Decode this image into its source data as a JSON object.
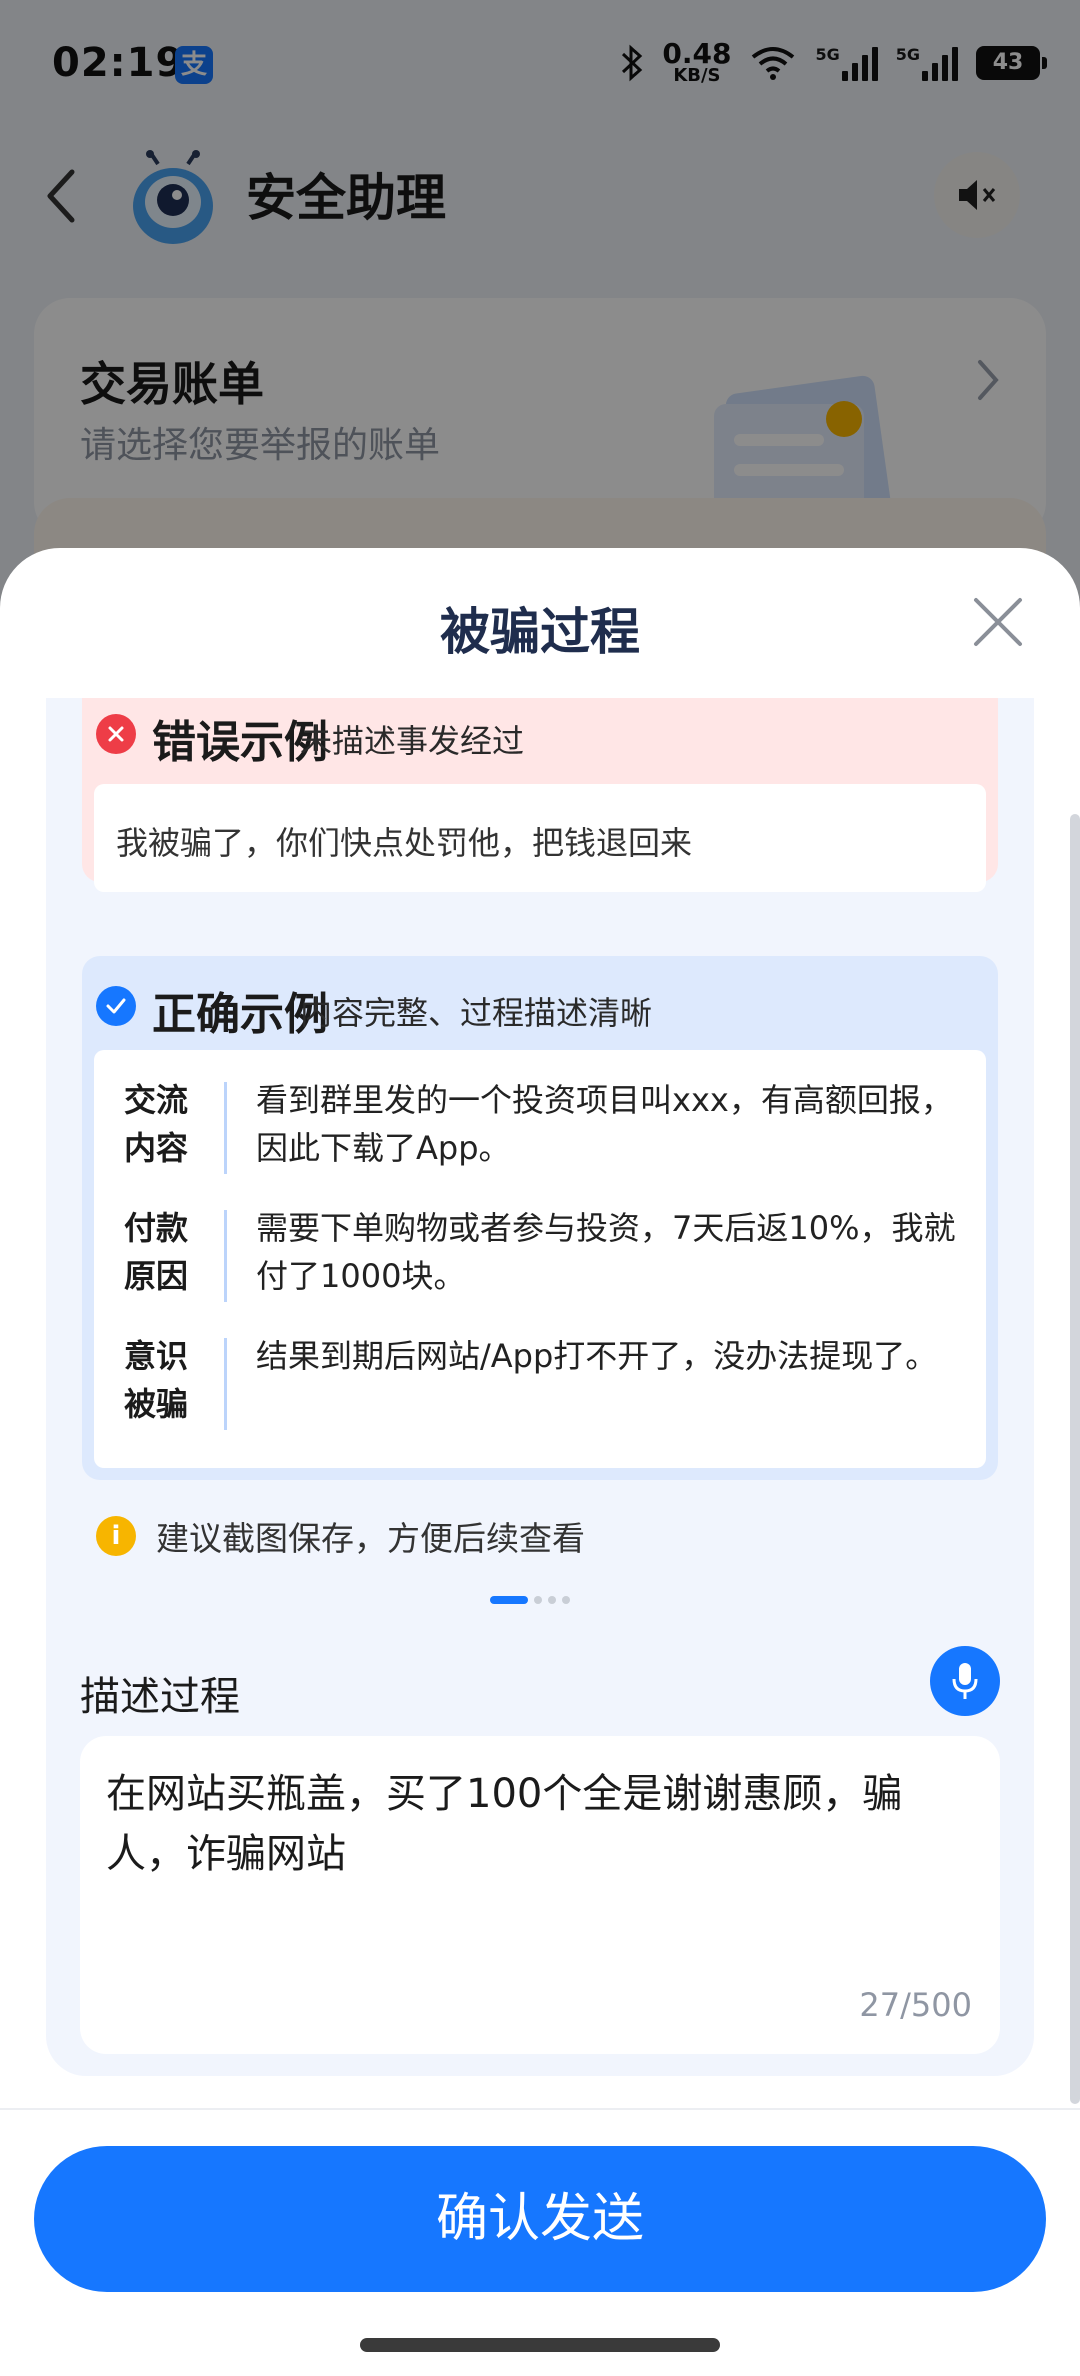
{
  "status_bar": {
    "time": "02:19",
    "notification_badge": "支",
    "net_speed_value": "0.48",
    "net_speed_unit": "KB/S",
    "signal_1_label": "5G",
    "signal_2_label": "5G",
    "battery": "43"
  },
  "header": {
    "title": "安全助理"
  },
  "bill_card": {
    "title": "交易账单",
    "subtitle": "请选择您要举报的账单"
  },
  "sheet": {
    "title": "被骗过程",
    "wrong_example": {
      "title": "错误示例",
      "desc": "未描述事发经过",
      "text": "我被骗了，你们快点处罚他，把钱退回来"
    },
    "right_example": {
      "title": "正确示例",
      "desc": "内容完整、过程描述清晰",
      "rows": [
        {
          "label": "交流内容",
          "text": "看到群里发的一个投资项目叫xxx，有高额回报，因此下载了App。"
        },
        {
          "label": "付款原因",
          "text": "需要下单购物或者参与投资，7天后返10%，我就付了1000块。"
        },
        {
          "label": "意识被骗",
          "text": "结果到期后网站/App打不开了，没办法提现了。"
        }
      ]
    },
    "tip": "建议截图保存，方便后续查看",
    "carousel": {
      "active_index": 1,
      "count": 4
    },
    "describe": {
      "label": "描述过程",
      "value": "在网站买瓶盖，买了100个全是谢谢惠顾，骗人，诈骗网站",
      "counter": "27/500"
    },
    "confirm_label": "确认发送"
  },
  "colors": {
    "accent": "#1677ff",
    "error": "#ee3d47",
    "warning": "#f7b500",
    "title_dark": "#1f2d4d"
  }
}
